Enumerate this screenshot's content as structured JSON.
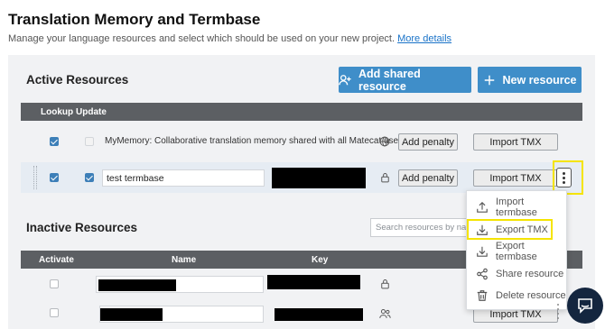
{
  "header": {
    "title": "Translation Memory and Termbase",
    "subtitle": "Manage your language resources and select which should be used on your new project.",
    "details_link": "More details"
  },
  "active": {
    "title": "Active Resources",
    "add_shared_label": "Add shared resource",
    "new_resource_label": "New resource",
    "columns": {
      "lookup": "Lookup",
      "update": "Update"
    },
    "rows": [
      {
        "name": "MyMemory: Collaborative translation memory shared with all Matecat users.",
        "lookup": true,
        "update": false,
        "penalty_label": "Add penalty",
        "import_label": "Import TMX",
        "icon": "globe-icon"
      },
      {
        "name": "test termbase",
        "lookup": true,
        "update": true,
        "penalty_label": "Add penalty",
        "import_label": "Import TMX",
        "icon": "lock-icon"
      }
    ]
  },
  "menu": {
    "items": [
      {
        "label": "Import termbase",
        "icon": "upload-icon"
      },
      {
        "label": "Export TMX",
        "icon": "download-icon"
      },
      {
        "label": "Export termbase",
        "icon": "download-icon"
      },
      {
        "label": "Share resource",
        "icon": "share-icon"
      },
      {
        "label": "Delete resource",
        "icon": "trash-icon"
      }
    ]
  },
  "inactive": {
    "title": "Inactive Resources",
    "search_placeholder": "Search resources by name",
    "columns": {
      "activate": "Activate",
      "name": "Name",
      "key": "Key"
    },
    "rows": [
      {
        "active": false,
        "icon": "lock-icon"
      },
      {
        "active": false,
        "icon": "users-icon",
        "import_label": "Import TMX"
      }
    ]
  },
  "colors": {
    "primary": "#3f8ec9",
    "highlight": "#f5e400",
    "table_header": "#5c5f63",
    "chat": "#14263f"
  }
}
